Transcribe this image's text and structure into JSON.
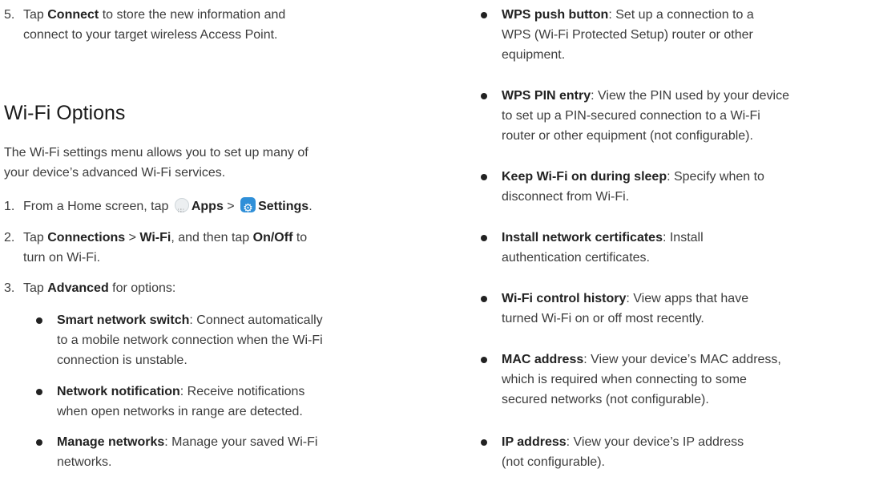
{
  "left": {
    "step5": {
      "num": "5.",
      "l1_pre": "Tap ",
      "l1_bold": "Connect",
      "l1_post": " to store the new information and",
      "l2": "connect to your target wireless Access Point."
    },
    "title": "Wi-Fi Options",
    "intro": [
      "The Wi-Fi settings menu allows you to set up many of",
      "your device’s advanced Wi-Fi services."
    ],
    "step1": {
      "num": "1.",
      "pre": "From a Home screen, tap ",
      "apps": "Apps",
      "sep": " > ",
      "settings": "Settings",
      "post": "."
    },
    "step2": {
      "num": "2.",
      "pre": "Tap ",
      "b1": "Connections",
      "sep": " > ",
      "b2": "Wi-Fi",
      "mid": ", and then tap ",
      "b3": "On/Off",
      "post": " to",
      "l2": "turn on Wi-Fi."
    },
    "step3": {
      "num": "3.",
      "pre": "Tap ",
      "b1": "Advanced",
      "post": " for options:"
    },
    "bullets": [
      {
        "bold": "Smart network switch",
        "l1": ": Connect automatically",
        "l2": "to a mobile network connection when the Wi-Fi",
        "l3": "connection is unstable."
      },
      {
        "bold": "Network notification",
        "l1": ": Receive notifications",
        "l2": "when open networks in range are detected.",
        "l3": ""
      },
      {
        "bold": "Manage networks",
        "l1": ": Manage your saved Wi-Fi",
        "l2": "networks.",
        "l3": ""
      }
    ]
  },
  "right": {
    "bullets": [
      {
        "bold": "WPS push button",
        "l1": ": Set up a connection to a",
        "l2": "WPS (Wi-Fi Protected Setup) router or other",
        "l3": "equipment."
      },
      {
        "bold": "WPS PIN entry",
        "l1": ": View the PIN used by your device",
        "l2": "to set up a PIN-secured connection to a Wi-Fi",
        "l3": "router or other equipment (not configurable)."
      },
      {
        "bold": "Keep Wi-Fi on during sleep",
        "l1": ": Specify when to",
        "l2": "disconnect from Wi-Fi.",
        "l3": ""
      },
      {
        "bold": "Install network certificates",
        "l1": ": Install",
        "l2": "authentication certificates.",
        "l3": ""
      },
      {
        "bold": "Wi-Fi control history",
        "l1": ": View apps that have",
        "l2": "turned Wi-Fi on or off most recently.",
        "l3": ""
      },
      {
        "bold": "MAC address",
        "l1": ": View your device’s MAC address,",
        "l2": "which is required when connecting to some",
        "l3": "secured networks (not configurable)."
      },
      {
        "bold": "IP address",
        "l1": ": View your device’s IP address",
        "l2": "(not configurable).",
        "l3": ""
      }
    ]
  }
}
